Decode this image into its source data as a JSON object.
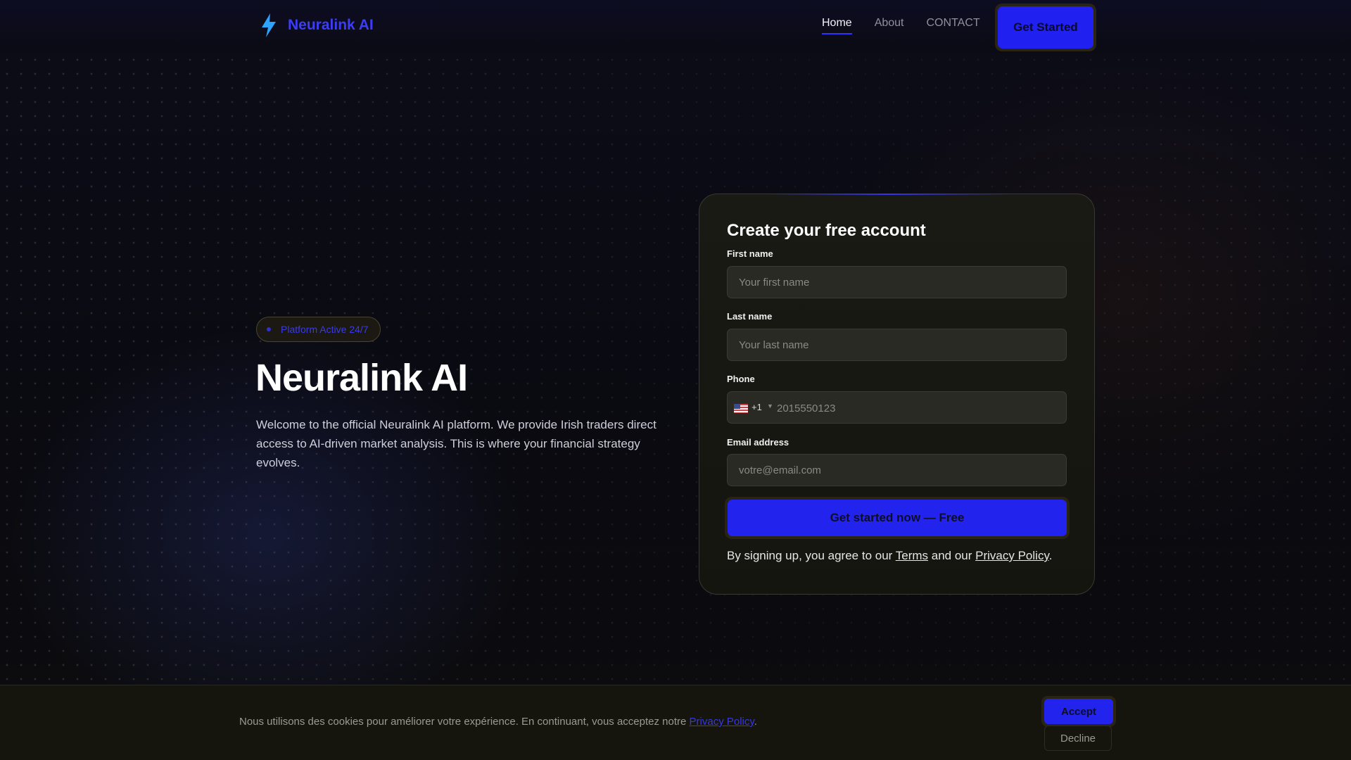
{
  "brand": {
    "name": "Neuralink AI",
    "icon": "lightning-bolt-icon",
    "color": "#3d3df5"
  },
  "nav": {
    "links": [
      {
        "label": "Home",
        "active": true
      },
      {
        "label": "About",
        "active": false
      },
      {
        "label": "CONTACT",
        "active": false
      }
    ],
    "cta_label": "Get Started"
  },
  "hero": {
    "badge": "Platform Active 24/7",
    "title": "Neuralink AI",
    "description": "Welcome to the official Neuralink AI platform. We provide Irish traders direct access to AI-driven market analysis. This is where your financial strategy evolves."
  },
  "signup": {
    "title": "Create your free account",
    "first_name": {
      "label": "First name",
      "placeholder": "Your first name",
      "value": ""
    },
    "last_name": {
      "label": "Last name",
      "placeholder": "Your last name",
      "value": ""
    },
    "phone": {
      "label": "Phone",
      "country_flag": "us-flag-icon",
      "dial_code": "+1",
      "placeholder": "2015550123",
      "value": ""
    },
    "email": {
      "label": "Email address",
      "placeholder": "votre@email.com",
      "value": ""
    },
    "submit_label": "Get started now — Free",
    "terms": {
      "prefix": "By signing up, you agree to our ",
      "terms_link": "Terms",
      "middle": " and our ",
      "privacy_link": "Privacy Policy",
      "suffix": "."
    }
  },
  "cookie": {
    "text": "Nous utilisons des cookies pour améliorer votre expérience. En continuant, vous acceptez notre ",
    "link": "Privacy Policy",
    "suffix": ".",
    "accept_label": "Accept",
    "decline_label": "Decline"
  },
  "colors": {
    "accent": "#2323ee",
    "background": "#0b0b10",
    "card": "#1a1a14"
  }
}
